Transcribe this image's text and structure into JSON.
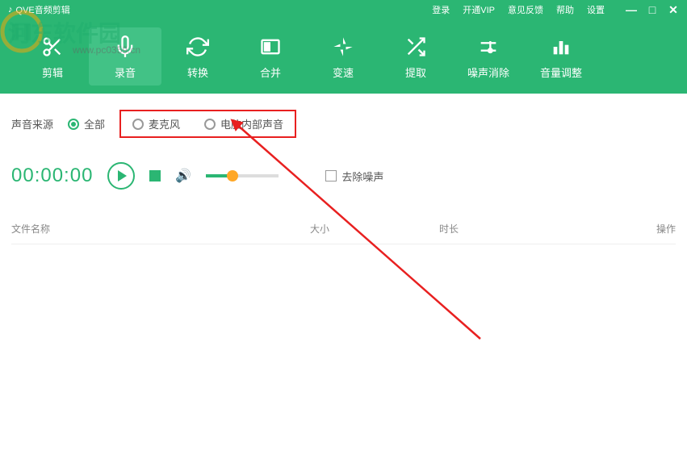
{
  "titlebar": {
    "app_title": "QVE音频剪辑",
    "links": {
      "login": "登录",
      "vip": "开通VIP",
      "feedback": "意见反馈",
      "help": "帮助",
      "settings": "设置"
    }
  },
  "toolbar": {
    "items": [
      {
        "label": "剪辑",
        "icon": "cut"
      },
      {
        "label": "录音",
        "icon": "mic",
        "active": true
      },
      {
        "label": "转换",
        "icon": "convert"
      },
      {
        "label": "合并",
        "icon": "merge"
      },
      {
        "label": "变速",
        "icon": "speed"
      },
      {
        "label": "提取",
        "icon": "extract"
      },
      {
        "label": "噪声消除",
        "icon": "denoise"
      },
      {
        "label": "音量调整",
        "icon": "volume"
      }
    ]
  },
  "source": {
    "label": "声音来源",
    "options": {
      "all": "全部",
      "mic": "麦克风",
      "internal": "电脑内部声音"
    },
    "selected": "all"
  },
  "controls": {
    "timer": "00:00:00",
    "denoise_label": "去除噪声"
  },
  "table": {
    "headers": {
      "name": "文件名称",
      "size": "大小",
      "duration": "时长",
      "action": "操作"
    }
  },
  "watermark": {
    "text": "河东软件园",
    "url": "www.pc0359.cn"
  }
}
